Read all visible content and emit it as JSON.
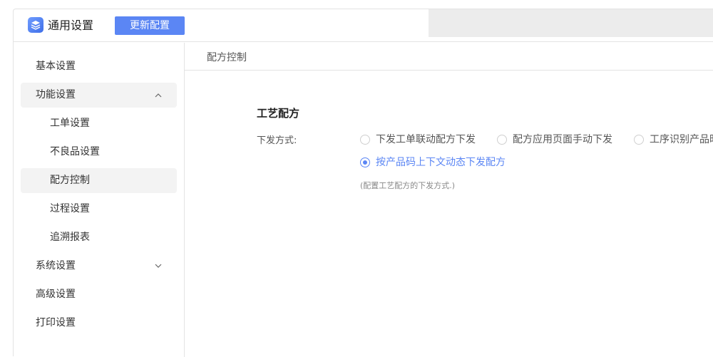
{
  "header": {
    "app_title": "通用设置",
    "update_button": "更新配置",
    "logo_icon": "layers-icon"
  },
  "sidebar": {
    "items": [
      {
        "label": "基本设置",
        "level": 1
      },
      {
        "label": "功能设置",
        "level": 1,
        "expanded": true,
        "chevron": "chevron-up-icon"
      },
      {
        "label": "工单设置",
        "level": 2
      },
      {
        "label": "不良品设置",
        "level": 2
      },
      {
        "label": "配方控制",
        "level": 2,
        "active": true
      },
      {
        "label": "过程设置",
        "level": 2
      },
      {
        "label": "追溯报表",
        "level": 2
      },
      {
        "label": "系统设置",
        "level": 1,
        "expanded": false,
        "chevron": "chevron-down-icon"
      },
      {
        "label": "高级设置",
        "level": 1
      },
      {
        "label": "打印设置",
        "level": 1
      }
    ]
  },
  "main": {
    "breadcrumb": "配方控制",
    "section_title": "工艺配方",
    "field_label": "下发方式:",
    "options": [
      {
        "label": "下发工单联动配方下发",
        "checked": false
      },
      {
        "label": "配方应用页面手动下发",
        "checked": false
      },
      {
        "label": "工序识别产品时",
        "checked": false
      },
      {
        "label": "按产品码上下文动态下发配方",
        "checked": true
      }
    ],
    "hint": "(配置工艺配方的下发方式.)"
  },
  "colors": {
    "accent": "#5b86f4",
    "active_bg": "#f3f3f3",
    "border": "#e3e3e3"
  }
}
